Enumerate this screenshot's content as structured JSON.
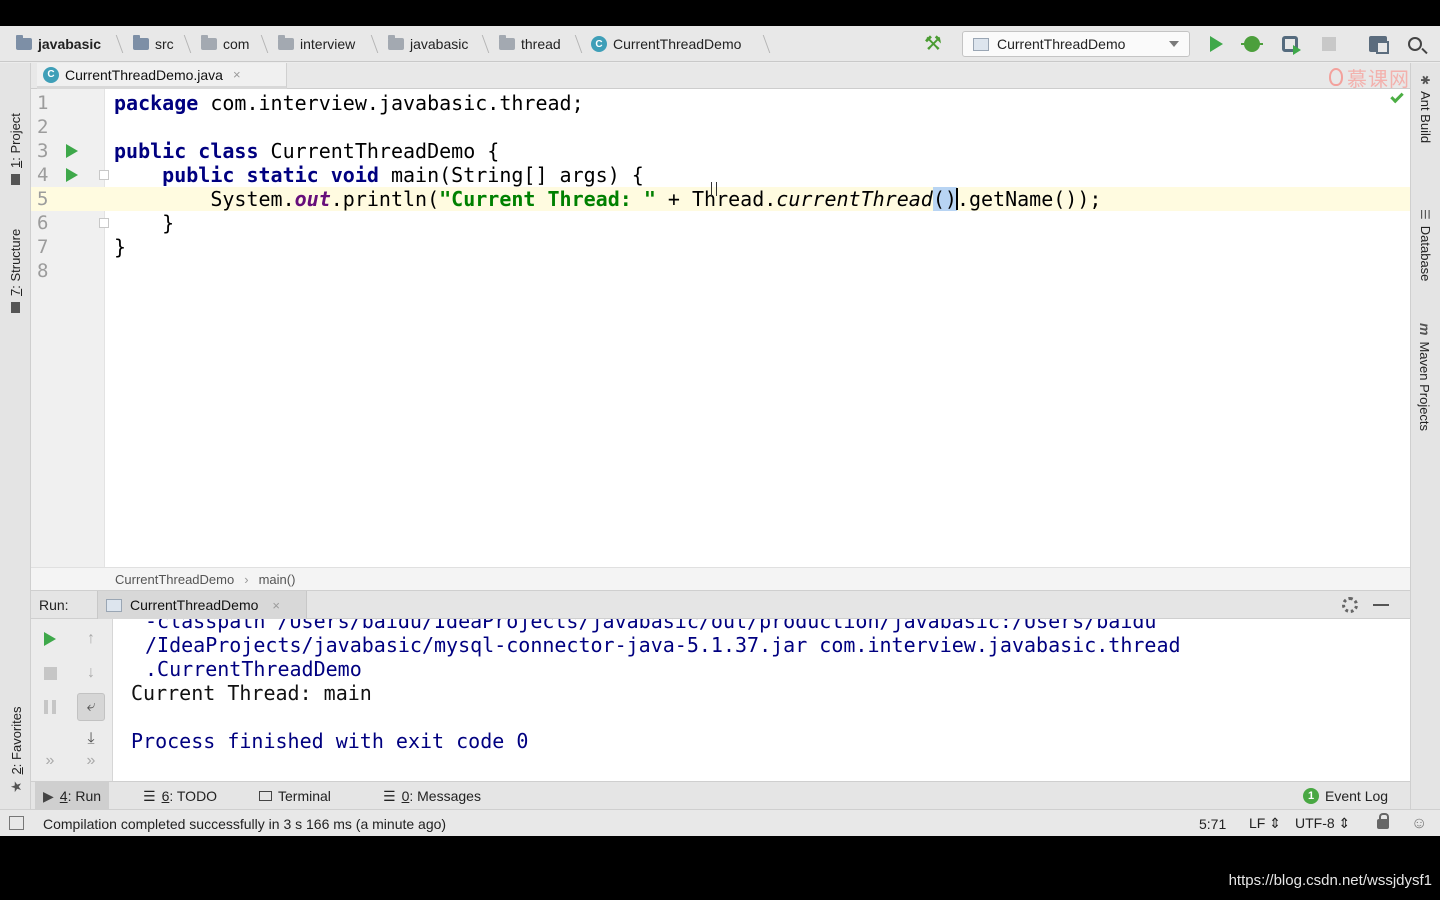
{
  "navbar": {
    "breadcrumbs": [
      "javabasic",
      "src",
      "com",
      "interview",
      "javabasic",
      "thread",
      "CurrentThreadDemo"
    ],
    "run_config": "CurrentThreadDemo"
  },
  "side_tabs": {
    "left_top": [
      {
        "num": "1",
        "label": ": Project"
      },
      {
        "num": "7",
        "label": ": Structure"
      }
    ],
    "left_bottom": {
      "num": "2",
      "label": ": Favorites"
    },
    "right": [
      "Ant Build",
      "Database",
      "Maven Projects"
    ],
    "maven_glyph": "m"
  },
  "editor": {
    "file_tab": "CurrentThreadDemo.java",
    "close_glyph": "×",
    "watermark": "慕课网",
    "line_numbers": [
      "1",
      "2",
      "3",
      "4",
      "5",
      "6",
      "7",
      "8"
    ],
    "code": {
      "l1_kw": "package",
      "l1_rest": " com.interview.javabasic.thread;",
      "l3_kw": "public class",
      "l3_rest": " CurrentThreadDemo {",
      "l4_indent": "    ",
      "l4_kw": "public static void",
      "l4_rest": " main(String[] args) {",
      "l5_pre": "        System.",
      "l5_field": "out",
      "l5_mid": ".println(",
      "l5_str": "\"Current Thread: \"",
      "l5_plus": " + Thread.",
      "l5_method": "currentThread",
      "l5_paren": "()",
      "l5_end": ".getName());",
      "l6": "    }",
      "l7": "}"
    },
    "breadcrumb": [
      "CurrentThreadDemo",
      "main()"
    ],
    "breadcrumb_sep": "›"
  },
  "run_panel": {
    "label": "Run:",
    "tab": "CurrentThreadDemo",
    "console": [
      "-classpath /Users/baidu/IdeaProjects/javabasic/out/production/javabasic:/Users/baidu",
      "/IdeaProjects/javabasic/mysql-connector-java-5.1.37.jar com.interview.javabasic.thread",
      ".CurrentThreadDemo",
      "Current Thread: main",
      "",
      "Process finished with exit code 0"
    ],
    "more_glyph": "»"
  },
  "bottom_tabs": {
    "run": {
      "num": "4",
      "label": ": Run"
    },
    "todo": {
      "num": "6",
      "label": ": TODO"
    },
    "terminal": {
      "label": "Terminal"
    },
    "messages": {
      "num": "0",
      "label": ": Messages"
    },
    "event_log": {
      "count": "1",
      "label": "Event Log"
    }
  },
  "status": {
    "message": "Compilation completed successfully in 3 s 166 ms (a minute ago)",
    "position": "5:71",
    "line_sep": "LF ⇕",
    "encoding": "UTF-8 ⇕"
  },
  "overlay": {
    "url": "https://blog.csdn.net/wssjdysf1"
  }
}
